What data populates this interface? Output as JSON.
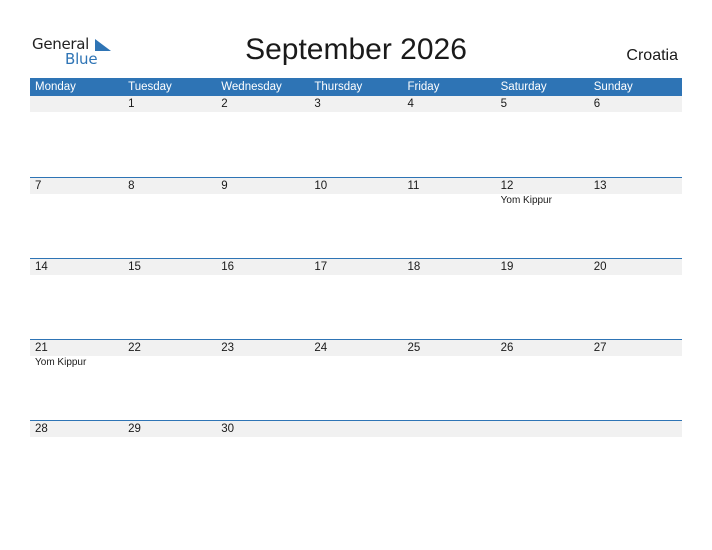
{
  "logo": {
    "line1": "General",
    "line2": "Blue",
    "accent_color": "#2e74b5"
  },
  "header": {
    "title": "September 2026",
    "country": "Croatia"
  },
  "calendar": {
    "header_color": "#2e74b5",
    "weekdays": [
      "Monday",
      "Tuesday",
      "Wednesday",
      "Thursday",
      "Friday",
      "Saturday",
      "Sunday"
    ],
    "weeks": [
      {
        "days": [
          {
            "date": "",
            "event": ""
          },
          {
            "date": "1",
            "event": ""
          },
          {
            "date": "2",
            "event": ""
          },
          {
            "date": "3",
            "event": ""
          },
          {
            "date": "4",
            "event": ""
          },
          {
            "date": "5",
            "event": ""
          },
          {
            "date": "6",
            "event": ""
          }
        ]
      },
      {
        "days": [
          {
            "date": "7",
            "event": ""
          },
          {
            "date": "8",
            "event": ""
          },
          {
            "date": "9",
            "event": ""
          },
          {
            "date": "10",
            "event": ""
          },
          {
            "date": "11",
            "event": ""
          },
          {
            "date": "12",
            "event": "Yom Kippur"
          },
          {
            "date": "13",
            "event": ""
          }
        ]
      },
      {
        "days": [
          {
            "date": "14",
            "event": ""
          },
          {
            "date": "15",
            "event": ""
          },
          {
            "date": "16",
            "event": ""
          },
          {
            "date": "17",
            "event": ""
          },
          {
            "date": "18",
            "event": ""
          },
          {
            "date": "19",
            "event": ""
          },
          {
            "date": "20",
            "event": ""
          }
        ]
      },
      {
        "days": [
          {
            "date": "21",
            "event": "Yom Kippur"
          },
          {
            "date": "22",
            "event": ""
          },
          {
            "date": "23",
            "event": ""
          },
          {
            "date": "24",
            "event": ""
          },
          {
            "date": "25",
            "event": ""
          },
          {
            "date": "26",
            "event": ""
          },
          {
            "date": "27",
            "event": ""
          }
        ]
      },
      {
        "days": [
          {
            "date": "28",
            "event": ""
          },
          {
            "date": "29",
            "event": ""
          },
          {
            "date": "30",
            "event": ""
          },
          {
            "date": "",
            "event": ""
          },
          {
            "date": "",
            "event": ""
          },
          {
            "date": "",
            "event": ""
          },
          {
            "date": "",
            "event": ""
          }
        ]
      }
    ]
  }
}
